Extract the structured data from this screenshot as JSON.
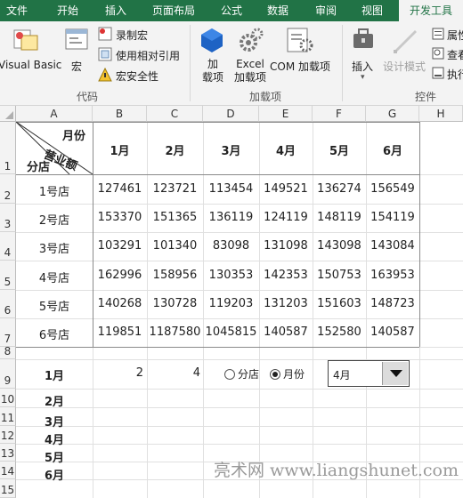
{
  "ribbon": {
    "tabs": [
      "文件",
      "开始",
      "插入",
      "页面布局",
      "公式",
      "数据",
      "审阅",
      "视图",
      "开发工具"
    ],
    "active_tab": "开发工具",
    "code_group": {
      "visual_basic": "Visual Basic",
      "macros": "宏",
      "record_macro": "录制宏",
      "use_relative": "使用相对引用",
      "macro_security": "宏安全性",
      "label": "代码"
    },
    "addins_group": {
      "addins_line1": "加",
      "addins_line2": "载项",
      "excel_line1": "Excel",
      "excel_line2": "加载项",
      "com_addins": "COM 加载项",
      "label": "加载项"
    },
    "controls_group": {
      "insert": "插入",
      "design_mode": "设计模式",
      "properties": "属性",
      "view_code": "查看",
      "run_dialog": "执行",
      "label": "控件"
    }
  },
  "grid": {
    "columns": [
      "A",
      "B",
      "C",
      "D",
      "E",
      "F",
      "G",
      "H"
    ],
    "rows": [
      "1",
      "2",
      "3",
      "4",
      "5",
      "6",
      "7",
      "8",
      "9",
      "10",
      "11",
      "12",
      "13",
      "14",
      "15"
    ],
    "header_cell": {
      "top_right": "月份",
      "middle": "营业额",
      "bottom_left": "分店"
    },
    "month_headers": [
      "1月",
      "2月",
      "3月",
      "4月",
      "5月",
      "6月"
    ],
    "table": [
      {
        "store": "1号店",
        "values": [
          "127461",
          "123721",
          "113454",
          "149521",
          "136274",
          "156549"
        ]
      },
      {
        "store": "2号店",
        "values": [
          "153370",
          "151365",
          "136119",
          "124119",
          "148119",
          "154119"
        ]
      },
      {
        "store": "3号店",
        "values": [
          "103291",
          "101340",
          "83098",
          "131098",
          "143098",
          "143084"
        ]
      },
      {
        "store": "4号店",
        "values": [
          "162996",
          "158956",
          "130353",
          "142353",
          "150753",
          "163953"
        ]
      },
      {
        "store": "5号店",
        "values": [
          "140268",
          "130728",
          "119203",
          "131203",
          "151603",
          "148723"
        ]
      },
      {
        "store": "6号店",
        "values": [
          "119851",
          "1187580",
          "1045815",
          "140587",
          "152580",
          "140587"
        ]
      }
    ],
    "row9_value_b": "2",
    "row9_value_c": "4",
    "month_list": [
      "1月",
      "2月",
      "3月",
      "4月",
      "5月",
      "6月"
    ],
    "radio_store": "分店",
    "radio_month": "月份",
    "combo_value": "4月"
  },
  "watermark": "亮术网 www.liangshunet.com",
  "colors": {
    "ribbon_green": "#217346"
  }
}
